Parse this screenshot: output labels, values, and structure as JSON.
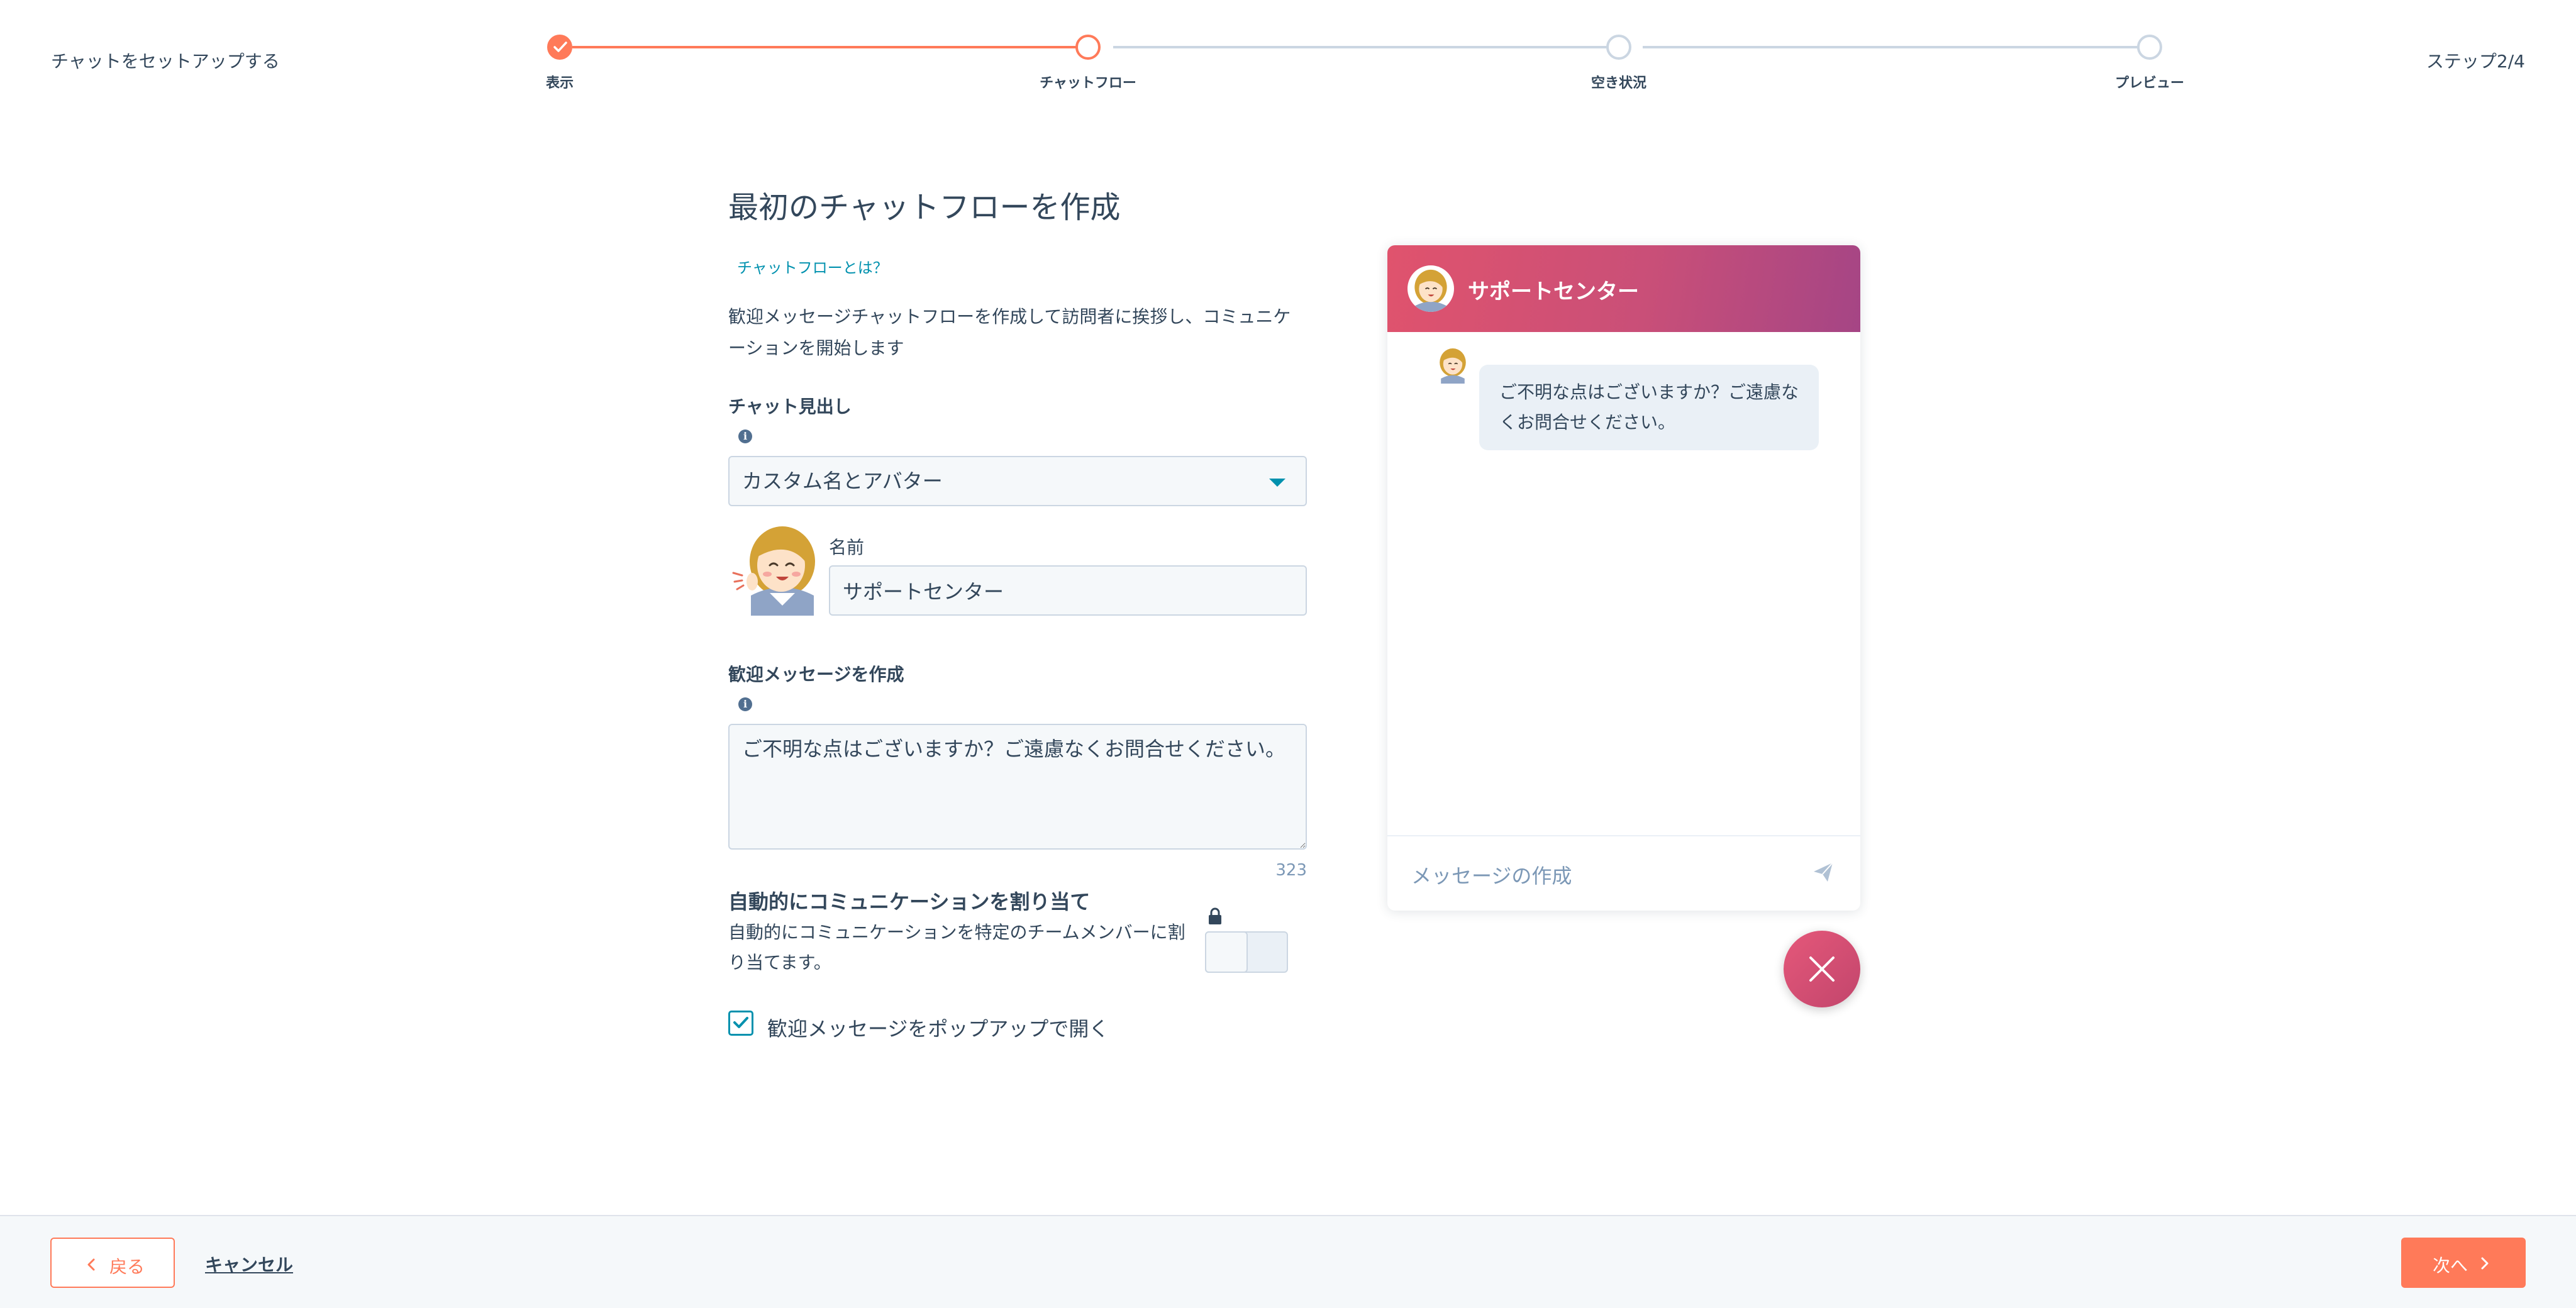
{
  "header": {
    "title": "チャットをセットアップする",
    "step_counter": "ステップ2/4"
  },
  "stepper": {
    "steps": [
      {
        "label": "表示",
        "state": "done"
      },
      {
        "label": "チャットフロー",
        "state": "current"
      },
      {
        "label": "空き状況",
        "state": "upcoming"
      },
      {
        "label": "プレビュー",
        "state": "upcoming"
      }
    ],
    "accent_color": "#ff7a59"
  },
  "form": {
    "title": "最初のチャットフローを作成",
    "help_link": "チャットフローとは？",
    "intro": "歓迎メッセージチャットフローを作成して訪問者に挨拶し、コミュニケーションを開始します",
    "heading_label": "チャット見出し",
    "heading_select": "カスタム名とアバター",
    "name_label": "名前",
    "name_value": "サポートセンター",
    "welcome_label": "歓迎メッセージを作成",
    "welcome_message": "ご不明な点はございますか？ご遠慮なくお問合せください。",
    "char_count": "323",
    "assign_title": "自動的にコミュニケーションを割り当て",
    "assign_desc": "自動的にコミュニケーションを特定のチームメンバーに割り当てます。",
    "assign_enabled": false,
    "popup_label": "歓迎メッセージをポップアップで開く",
    "popup_checked": true
  },
  "chat_preview": {
    "name": "サポートセンター",
    "message": "ご不明な点はございますか？ご遠慮なくお問合せください。",
    "composer_placeholder": "メッセージの作成",
    "header_color": "#d94f74"
  },
  "footer": {
    "back_label": "戻る",
    "cancel_label": "キャンセル",
    "next_label": "次へ"
  }
}
